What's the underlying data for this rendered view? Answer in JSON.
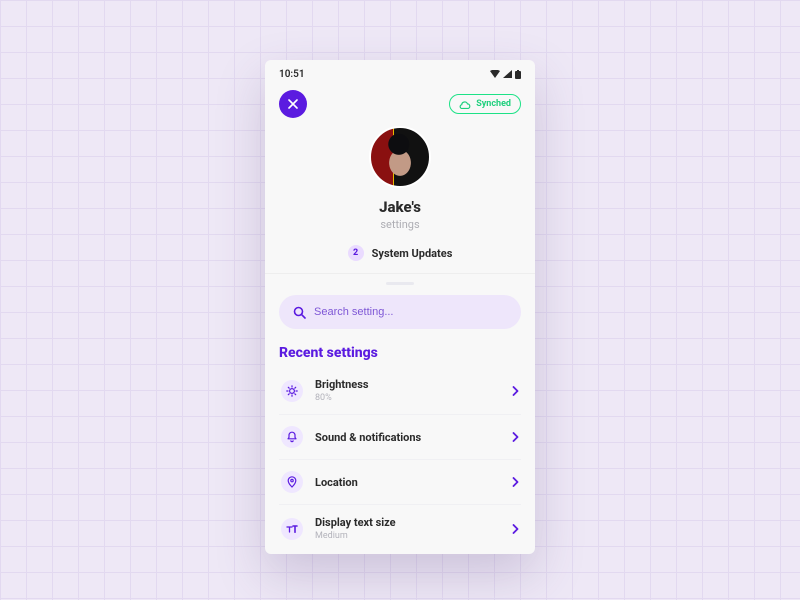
{
  "status": {
    "time": "10:51"
  },
  "header": {
    "sync_label": "Synched",
    "name": "Jake's",
    "subtitle": "settings",
    "updates_count": "2",
    "updates_label": "System Updates"
  },
  "search": {
    "placeholder": "Search setting..."
  },
  "section": {
    "title": "Recent settings"
  },
  "rows": [
    {
      "label": "Brightness",
      "sub": "80%"
    },
    {
      "label": "Sound & notifications",
      "sub": ""
    },
    {
      "label": "Location",
      "sub": ""
    },
    {
      "label": "Display text size",
      "sub": "Medium"
    }
  ],
  "colors": {
    "primary": "#5b1be0",
    "accent": "#1de287"
  }
}
